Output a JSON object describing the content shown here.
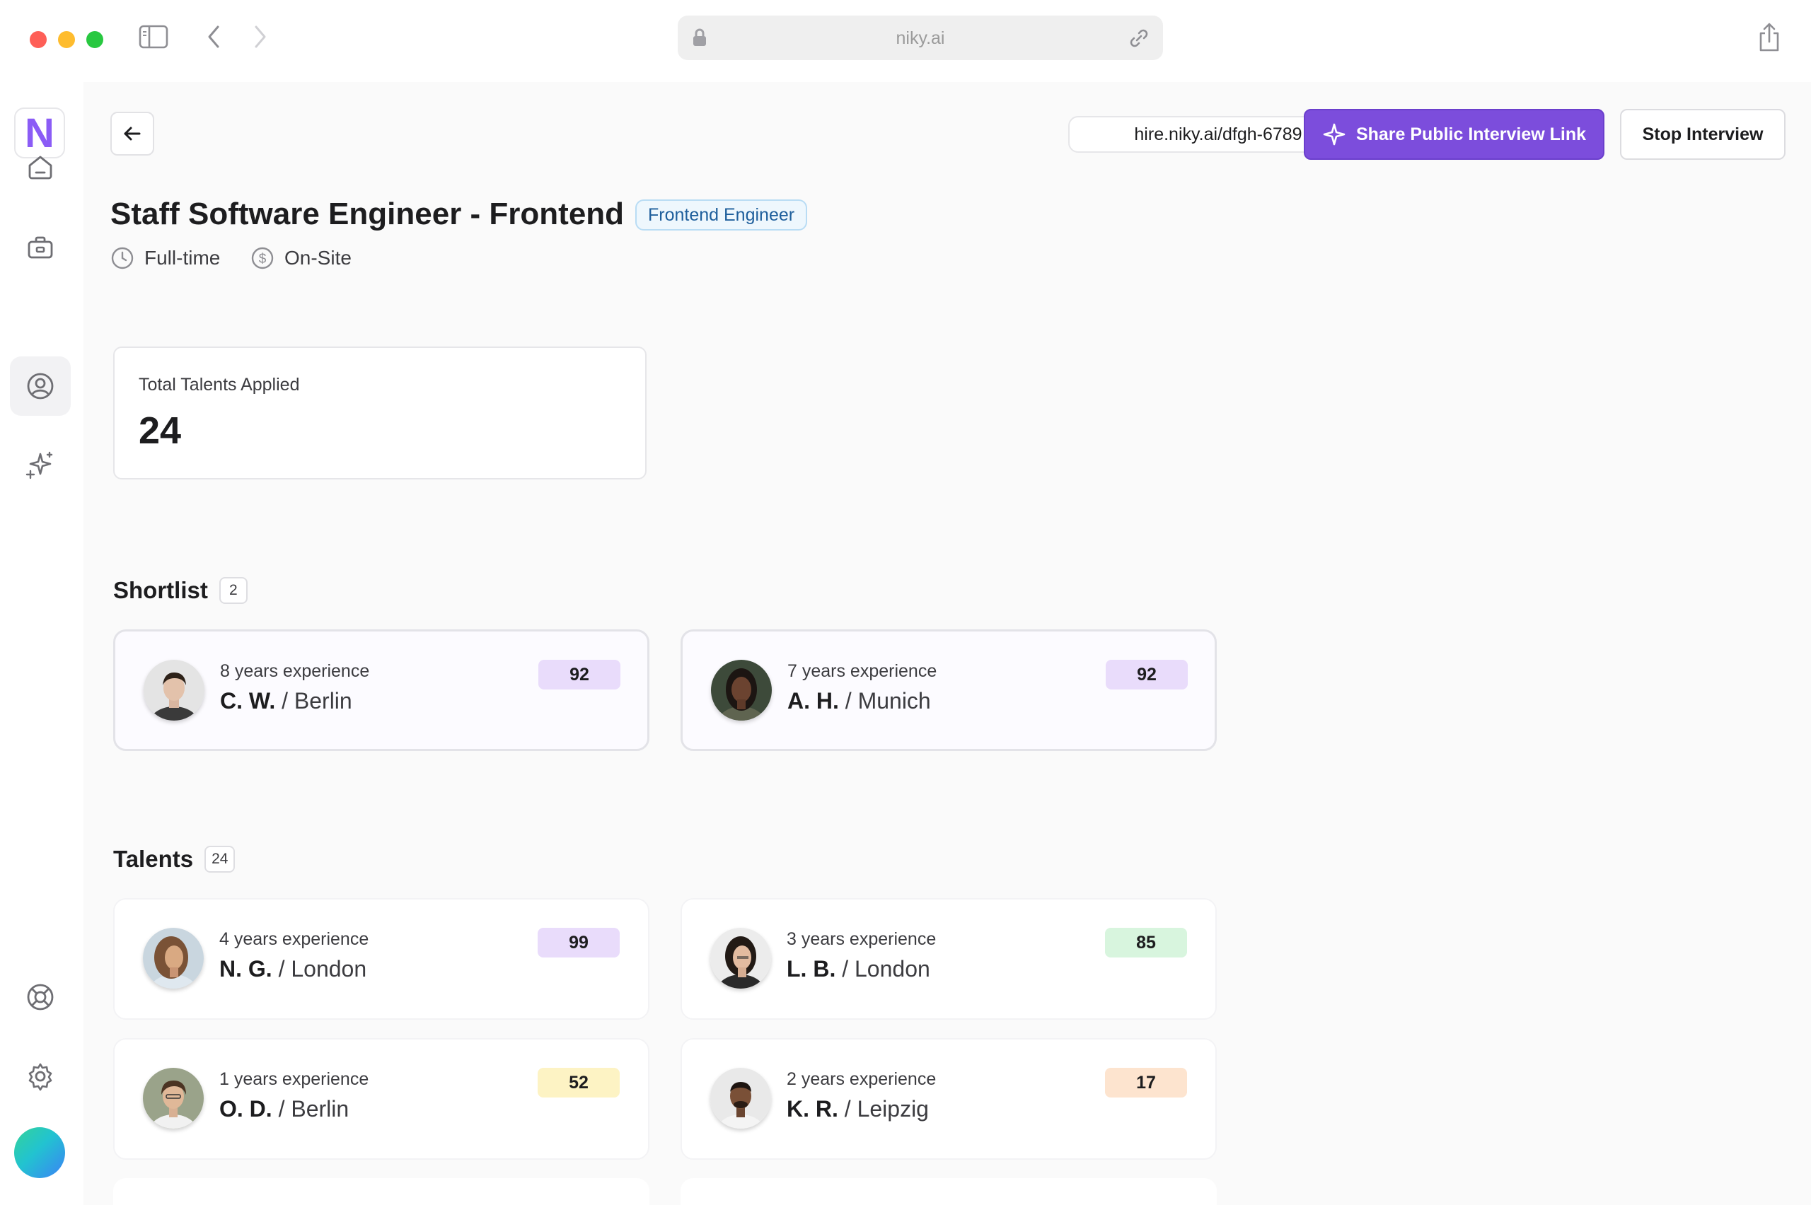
{
  "browser": {
    "url": "niky.ai"
  },
  "header": {
    "public_link": "hire.niky.ai/dfgh-6789",
    "share_button": "Share Public Interview Link",
    "stop_button": "Stop Interview"
  },
  "job": {
    "title": "Staff Software Engineer - Frontend",
    "badge": "Frontend Engineer",
    "employment_type": "Full-time",
    "location_type": "On-Site"
  },
  "stats": {
    "label": "Total Talents Applied",
    "value": "24"
  },
  "shortlist": {
    "title": "Shortlist",
    "count": "2",
    "items": [
      {
        "experience": "8 years experience",
        "name": "C. W.",
        "location": "Berlin",
        "score": "92",
        "score_color": "#e9dcfb"
      },
      {
        "experience": "7 years experience",
        "name": "A. H.",
        "location": "Munich",
        "score": "92",
        "score_color": "#e9dcfb"
      }
    ]
  },
  "talents": {
    "title": "Talents",
    "count": "24",
    "items": [
      {
        "experience": "4 years experience",
        "name": "N. G.",
        "location": "London",
        "score": "99",
        "score_color": "#e9dcfb"
      },
      {
        "experience": "3 years experience",
        "name": "L. B.",
        "location": "London",
        "score": "85",
        "score_color": "#d8f5de"
      },
      {
        "experience": "1 years experience",
        "name": "O. D.",
        "location": "Berlin",
        "score": "52",
        "score_color": "#fdf3c4"
      },
      {
        "experience": "2 years experience",
        "name": "K. R.",
        "location": "Leipzig",
        "score": "17",
        "score_color": "#fde4cf"
      }
    ]
  },
  "icons": {
    "sidebar": [
      "home-icon",
      "briefcase-icon",
      "user-circle-icon",
      "sparkles-icon",
      "lifebuoy-icon",
      "gear-icon"
    ],
    "accent": "#7c4ddc"
  }
}
